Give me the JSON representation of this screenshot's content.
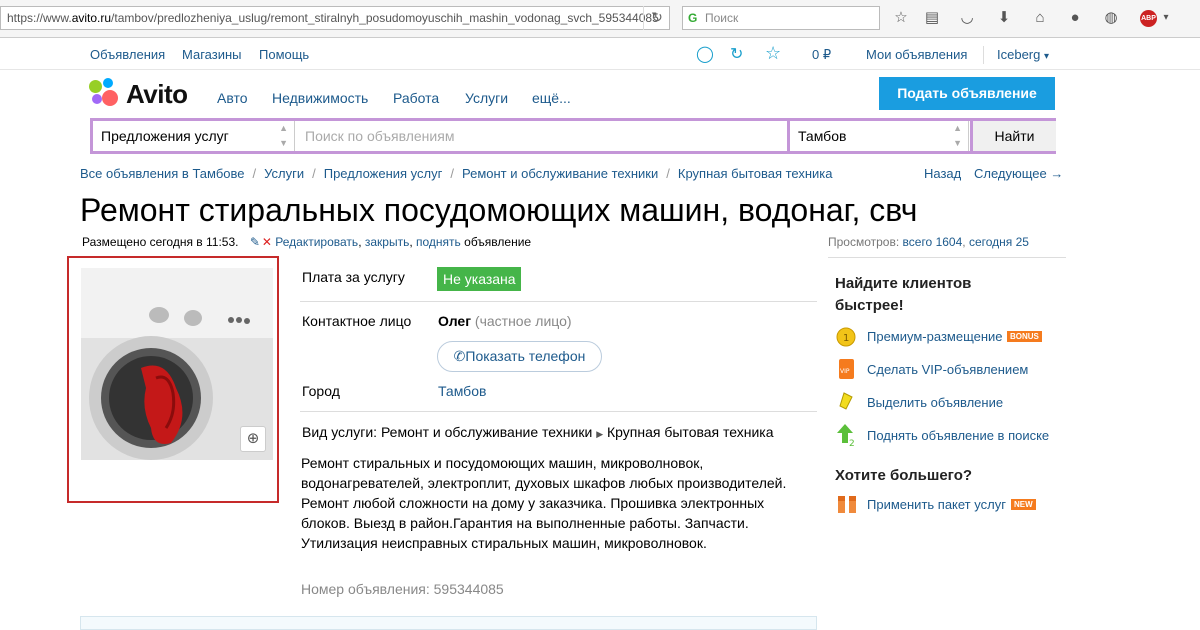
{
  "browser": {
    "url_prefix": "https://www.",
    "url_host": "avito.ru",
    "url_path": "/tambov/predlozheniya_uslug/remont_stiralnyh_posudomoyuschih_mashin_vodonag_svch_595344085",
    "search_placeholder": "Поиск",
    "abp_label": "ABP"
  },
  "topnav": {
    "ads": "Объявления",
    "shops": "Магазины",
    "help": "Помощь",
    "balance": "0 ₽",
    "my_ads": "Мои объявления",
    "user": "Iceberg"
  },
  "logo": {
    "text": "Avito"
  },
  "categories": [
    "Авто",
    "Недвижимость",
    "Работа",
    "Услуги",
    "ещё..."
  ],
  "post_button": "Подать объявление",
  "search": {
    "category": "Предложения услуг",
    "placeholder": "Поиск по объявлениям",
    "city": "Тамбов",
    "button": "Найти"
  },
  "breadcrumbs": [
    "Все объявления в Тамбове",
    "Услуги",
    "Предложения услуг",
    "Ремонт и обслуживание техники",
    "Крупная бытовая техника"
  ],
  "nav": {
    "back": "Назад",
    "next": "Следующее →"
  },
  "ad": {
    "title": "Ремонт стиральных посудомоющих машин, водонаг, свч",
    "posted": "Размещено сегодня в 11:53.",
    "edit": "Редактировать",
    "close": "закрыть",
    "raise": "поднять",
    "edit_tail": "объявление",
    "views_label": "Просмотров:",
    "views_total": "всего 1604",
    "views_today": "сегодня 25",
    "price_label": "Плата за услугу",
    "price_value": "Не указана",
    "contact_label": "Контактное лицо",
    "contact_name": "Олег",
    "contact_type": "(частное лицо)",
    "phone_button": "Показать телефон",
    "city_label": "Город",
    "city_value": "Тамбов",
    "service_label": "Вид услуги:",
    "service_value": "Ремонт и обслуживание техники",
    "service_sub": "Крупная бытовая техника",
    "description": "Ремонт стиральных и посудомоющих машин, микроволновок, водонагревателей, электроплит, духовых шкафов любых производителей. Ремонт любой сложности на дому у заказчика. Прошивка электронных блоков. Выезд в район.Гарантия на выполненные работы. Запчасти. Утилизация неисправных стиральных машин, микроволновок.",
    "ad_number": "Номер объявления: 595344085"
  },
  "sidebar": {
    "heading1": "Найдите клиентов быстрее!",
    "items": [
      {
        "label": "Премиум-размещение",
        "badge": "BONUS"
      },
      {
        "label": "Сделать VIP-объявлением",
        "badge": ""
      },
      {
        "label": "Выделить объявление",
        "badge": ""
      },
      {
        "label": "Поднять объявление в поиске",
        "badge": ""
      }
    ],
    "heading2": "Хотите большего?",
    "package": {
      "label": "Применить пакет услуг",
      "badge": "NEW"
    }
  },
  "colors": {
    "link": "#1d5a8c",
    "accent_blue": "#1a9de0",
    "search_border": "#c496d8",
    "price_green": "#45b549",
    "photo_border": "#c62a2a",
    "badge_orange": "#f57b1e"
  }
}
